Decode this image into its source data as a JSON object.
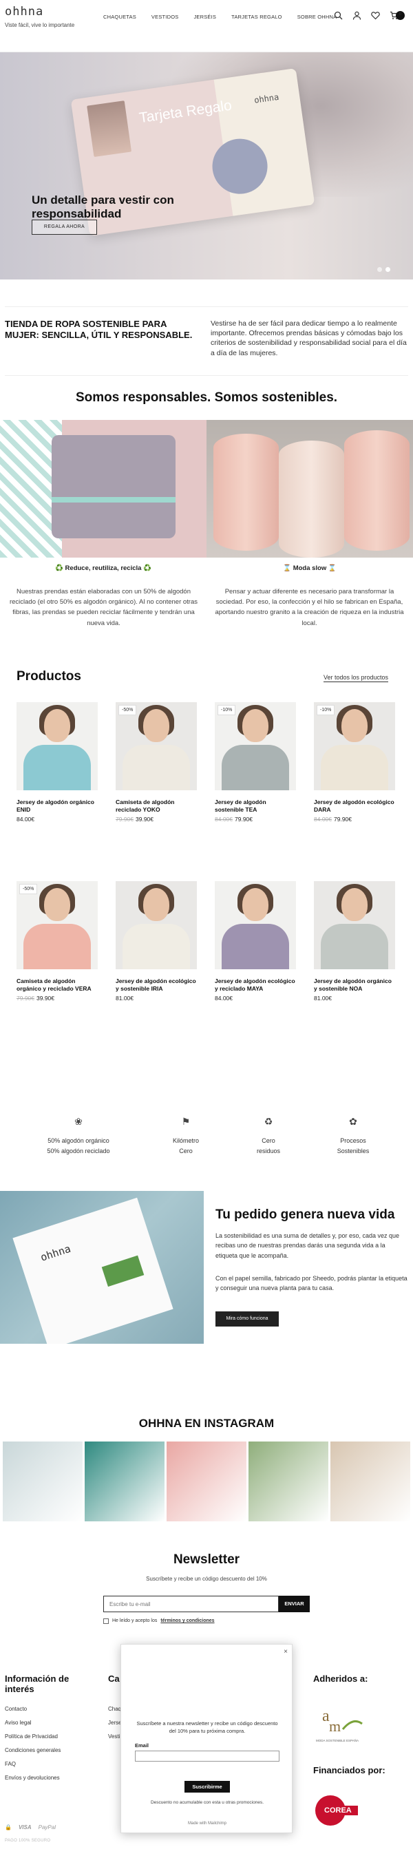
{
  "header": {
    "logo": "ohhna",
    "tagline": "Viste fácil, vive lo importante",
    "nav": [
      "CHAQUETAS",
      "VESTIDOS",
      "JERSÉIS",
      "TARJETAS REGALO",
      "SOBRE OHHNA"
    ],
    "cart_count": "0",
    "icons": [
      "search-icon",
      "user-icon",
      "heart-icon",
      "cart-icon"
    ]
  },
  "hero": {
    "card_title": "Tarjeta Regalo",
    "card_brand": "ohhna",
    "headline": "Un detalle para vestir con responsabilidad",
    "button": "REGALA AHORA"
  },
  "intro": {
    "left": "TIENDA DE ROPA SOSTENIBLE PARA MUJER: SENCILLA, ÚTIL Y RESPONSABLE.",
    "right": "Vestirse ha de ser fácil para dedicar tiempo a lo realmente importante. Ofrecemos prendas básicas y cómodas bajo los criterios de sostenibilidad y responsabilidad social para el día a día de las mujeres."
  },
  "sustainable": {
    "title": "Somos responsables. Somos sostenibles.",
    "features": [
      {
        "title": "♻️ Reduce, reutiliza, recicla ♻️",
        "text": "Nuestras prendas están elaboradas con un 50% de algodón reciclado (el otro 50% es algodón orgánico). Al no contener otras fibras, las prendas se pueden reciclar fácilmente y tendrán una nueva vida."
      },
      {
        "title": "⌛ Moda slow ⌛",
        "text": "Pensar y actuar diferente es necesario para transformar la sociedad. Por eso, la confección y el hilo se fabrican en España, aportando nuestro granito a la creación de riqueza en la industria local."
      }
    ]
  },
  "products": {
    "title": "Productos",
    "see_all": "Ver todos los productos",
    "items": [
      {
        "name": "Jersey de algodón orgánico ENID",
        "old_price": "",
        "price": "84.00€",
        "badge": "",
        "color": "#8cc9d2"
      },
      {
        "name": "Camiseta de algodón reciclado YOKO",
        "old_price": "79.90€",
        "price": "39.90€",
        "badge": "-50%",
        "color": "#eeeae1"
      },
      {
        "name": "Jersey de algodón sostenible TEA",
        "old_price": "84.00€",
        "price": "79.90€",
        "badge": "-10%",
        "color": "#aab3b3"
      },
      {
        "name": "Jersey de algodón ecológico DARA",
        "old_price": "84.00€",
        "price": "79.90€",
        "badge": "-10%",
        "color": "#ede6d8"
      },
      {
        "name": "Camiseta de algodón orgánico y reciclado VERA",
        "old_price": "79.90€",
        "price": "39.90€",
        "badge": "-50%",
        "color": "#efb5a8"
      },
      {
        "name": "Jersey de algodón ecológico y sostenible IRIA",
        "old_price": "",
        "price": "81.00€",
        "badge": "",
        "color": "#f0ede4"
      },
      {
        "name": "Jersey de algodón ecológico y reciclado MAYA",
        "old_price": "",
        "price": "84.00€",
        "badge": "",
        "color": "#9e93b0"
      },
      {
        "name": "Jersey de algodón orgánico y sostenible NOA",
        "old_price": "",
        "price": "81.00€",
        "badge": "",
        "color": "#c2c8c4"
      }
    ]
  },
  "features": [
    {
      "icon": "cotton-icon",
      "line1": "50% algodón orgánico",
      "line2": "50% algodón reciclado"
    },
    {
      "icon": "km-zero-icon",
      "line1": "Kilómetro",
      "line2": "Cero"
    },
    {
      "icon": "zero-waste-icon",
      "line1": "Cero",
      "line2": "residuos"
    },
    {
      "icon": "process-icon",
      "line1": "Procesos",
      "line2": "Sostenibles"
    }
  ],
  "order": {
    "title": "Tu pedido genera nueva vida",
    "p1": "La sostenibilidad es una suma de detalles y, por eso, cada vez que recibas uno de nuestras prendas darás una segunda vida a la etiqueta que le acompaña.",
    "p2": "Con el papel semilla, fabricado por Sheedo, podrás plantar la etiqueta y conseguir una nueva planta para tu casa.",
    "button": "Mira cómo funciona",
    "card_brand": "ohhna"
  },
  "instagram": {
    "title": "OHHNA EN INSTAGRAM",
    "tiles": [
      "#c9d7d9",
      "#2f8a80",
      "#e9a7a3",
      "#8fae7b",
      "#d8c6b1"
    ]
  },
  "newsletter": {
    "title": "Newsletter",
    "subtitle": "Suscríbete y recibe un código descuento del 10%",
    "placeholder": "Escribe tu e-mail",
    "button": "ENVIAR",
    "consent_prefix": "He leído y acepto los",
    "consent_link": "términos y condiciones"
  },
  "footer": {
    "info_title": "Información de interés",
    "links": [
      "Contacto",
      "Aviso legal",
      "Política de Privacidad",
      "Condiciones generales",
      "FAQ",
      "Envíos y devoluciones"
    ],
    "col2_title": "Ca",
    "col2_links": [
      "Chaq",
      "Jerse",
      "Vesti"
    ],
    "adheridos_title": "Adheridos a:",
    "amse_caption": "MODA SOSTENIBLE ESPAÑA",
    "financiados_title": "Financiados por:",
    "corea_label": "COREA",
    "pay_methods": [
      "VISA",
      "PayPal"
    ],
    "pay_note": "PAGO 100% SEGURO"
  },
  "popup": {
    "close": "×",
    "text": "Suscríbete a nuestra newsletter y recibe un código descuento del 10% para tu próxima compra.",
    "email_label": "Email",
    "button": "Suscribirme",
    "note": "Descuento no acumulable con esta u otras promociones.",
    "made_with": "Made with Mailchimp"
  }
}
